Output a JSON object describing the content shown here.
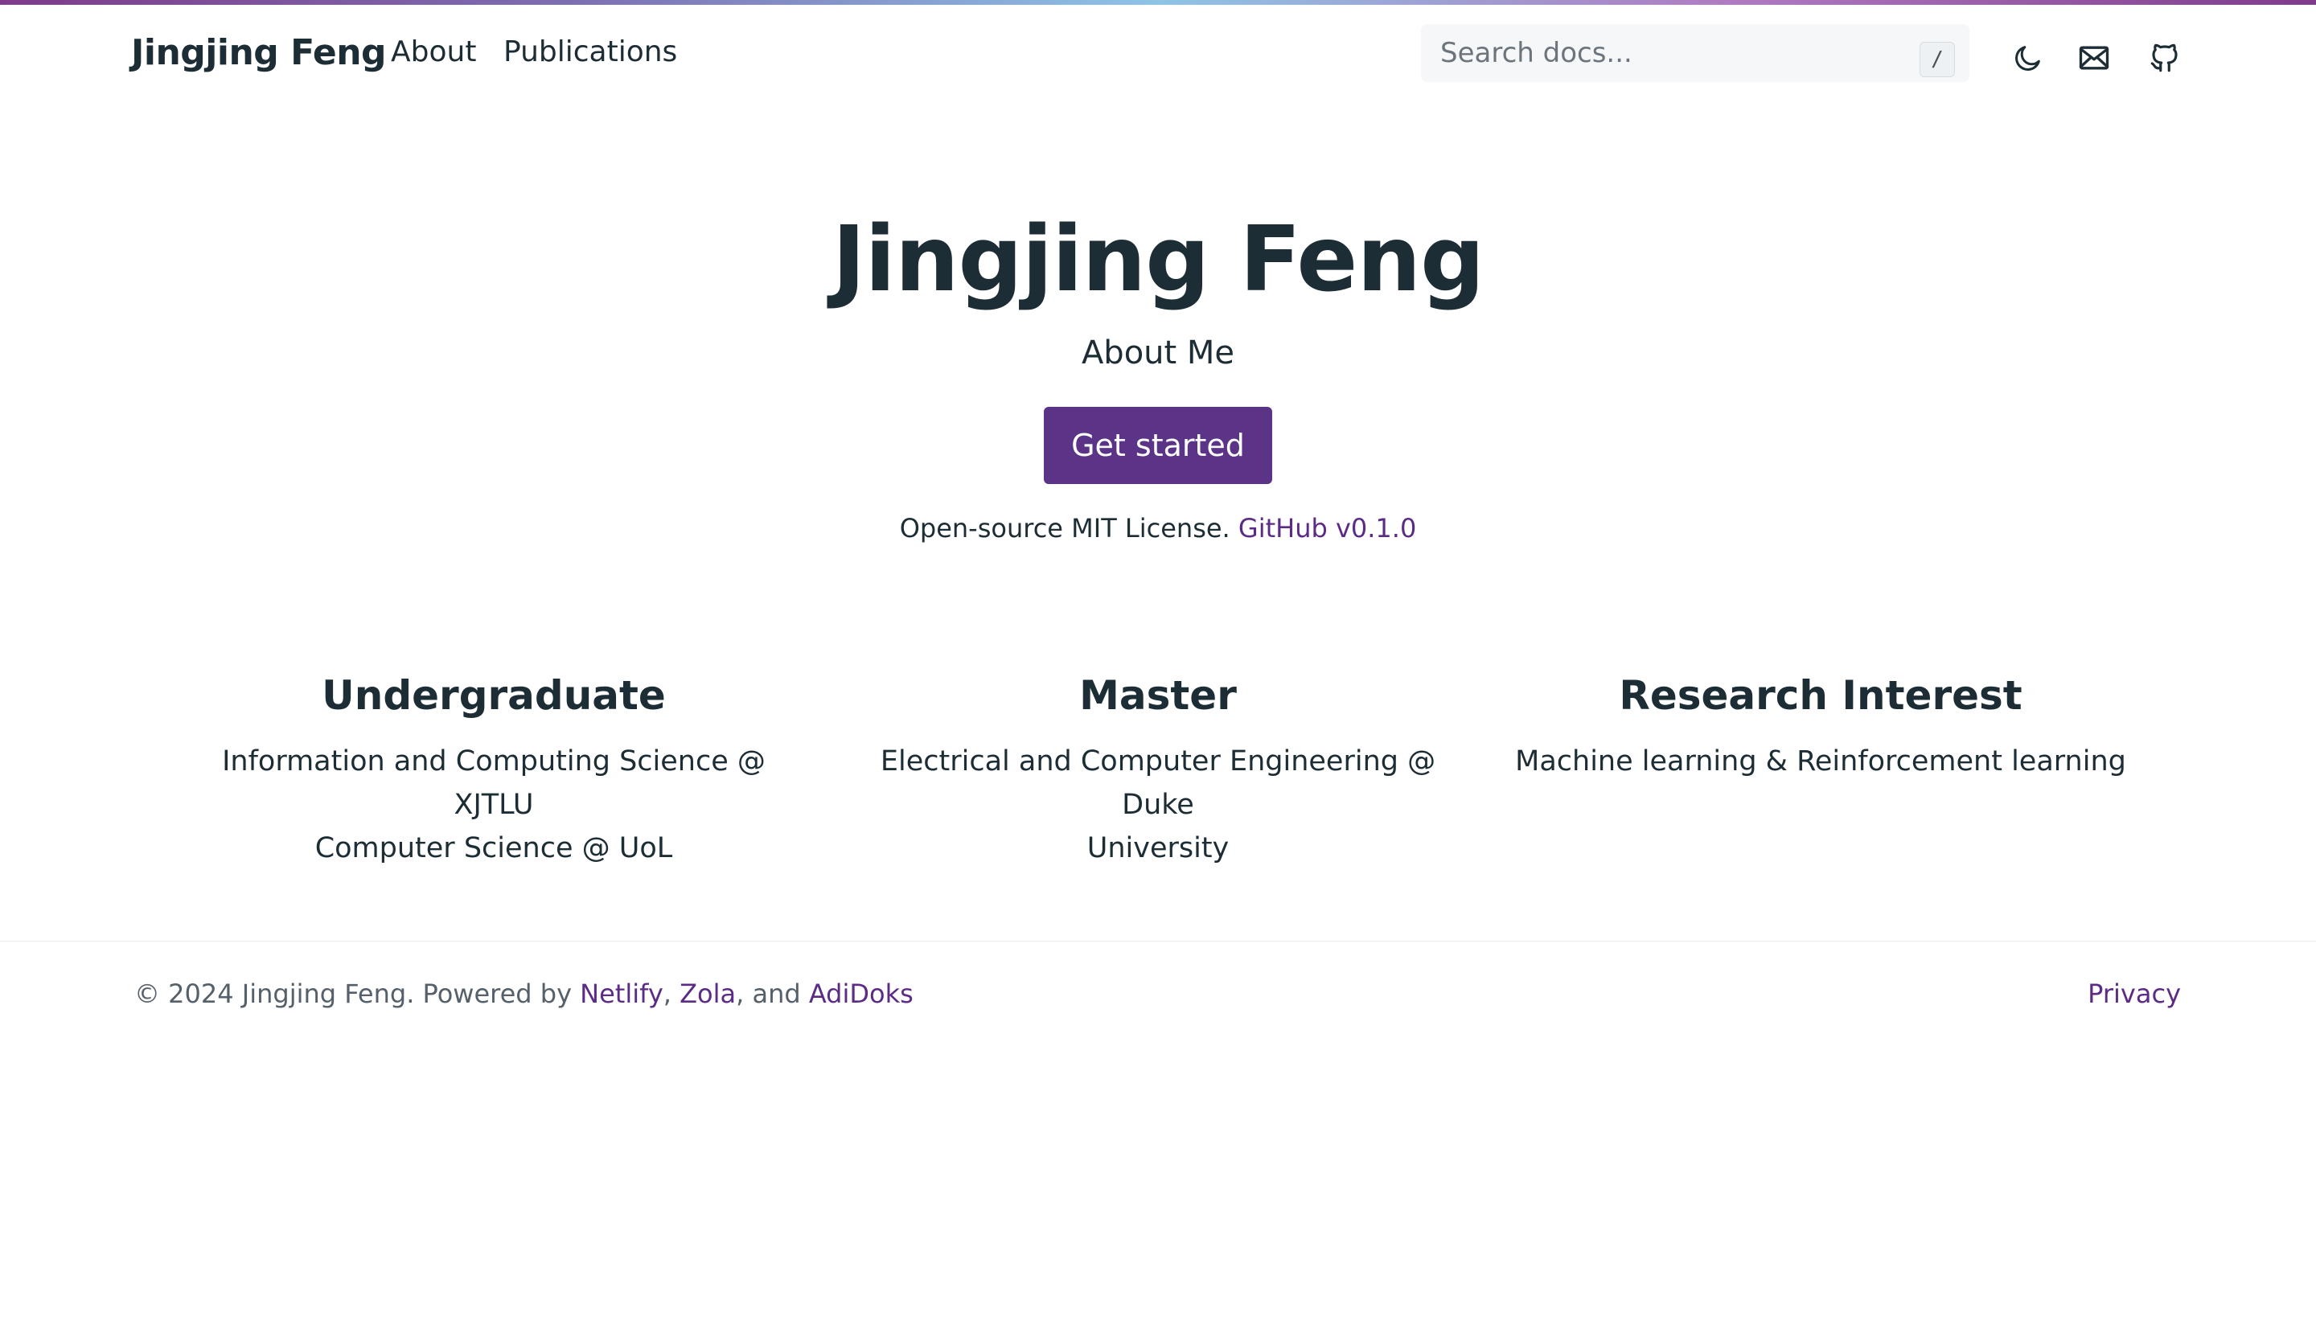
{
  "colors": {
    "accent": "#5b3487",
    "link": "#5b2b86",
    "text": "#1d2d35",
    "muted": "#55606a"
  },
  "header": {
    "brand": "Jingjing Feng",
    "nav": [
      {
        "label": "About"
      },
      {
        "label": "Publications"
      }
    ],
    "search": {
      "placeholder": "Search docs...",
      "shortcut": "/"
    },
    "icons": [
      "moon-icon",
      "mail-icon",
      "github-icon"
    ]
  },
  "hero": {
    "title": "Jingjing Feng",
    "subtitle": "About Me",
    "button": "Get started",
    "license_text": "Open-source MIT License.",
    "license_link": "GitHub v0.1.0"
  },
  "features": [
    {
      "title": "Undergraduate",
      "lines": [
        "Information and Computing Science @ XJTLU",
        "Computer Science @ UoL"
      ]
    },
    {
      "title": "Master",
      "lines": [
        "Electrical and Computer Engineering @ Duke",
        "University"
      ]
    },
    {
      "title": "Research Interest",
      "lines": [
        "Machine learning & Reinforcement learning"
      ]
    }
  ],
  "footer": {
    "copyright": "© 2024 Jingjing Feng. Powered by",
    "links": [
      "Netlify",
      "Zola",
      "AdiDoks"
    ],
    "sep1": ",",
    "sep2": ", and",
    "privacy": "Privacy"
  }
}
